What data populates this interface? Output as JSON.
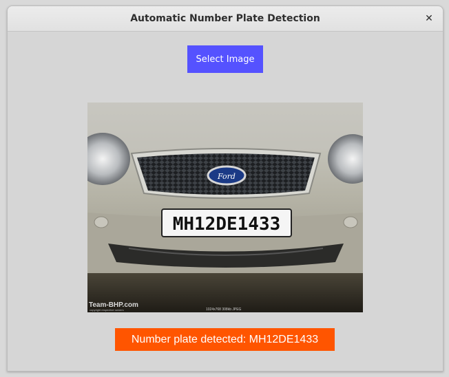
{
  "window": {
    "title": "Automatic Number Plate Detection",
    "close_glyph": "✕"
  },
  "toolbar": {
    "select_label": "Select Image"
  },
  "image": {
    "plate_text": "MH12DE1433",
    "logo_text": "Ford",
    "watermark": "Team-BHP.com",
    "watermark_sub": "copyright respective owners",
    "info": "1024x768 308kb JPEG"
  },
  "result": {
    "text": "Number plate detected: MH12DE1433"
  },
  "colors": {
    "button": "#5552ff",
    "result": "#ff5500"
  }
}
